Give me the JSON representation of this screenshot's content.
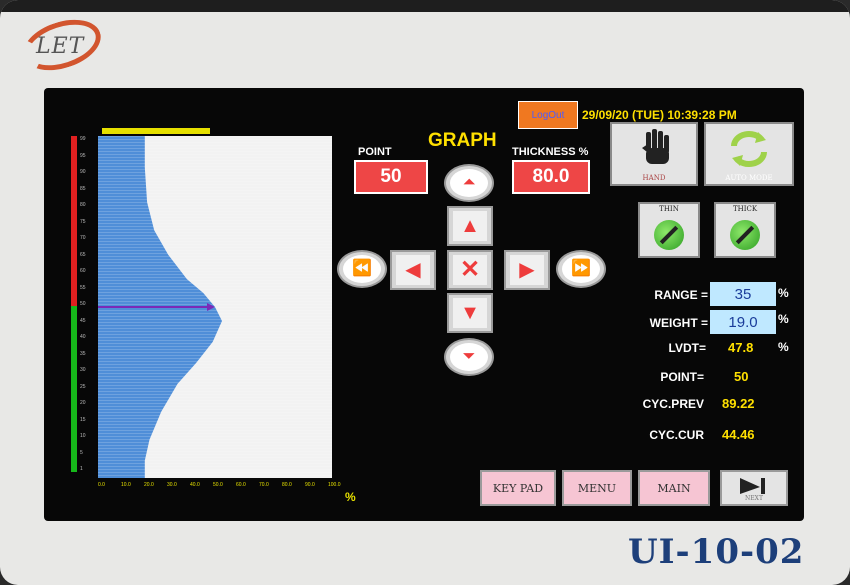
{
  "device": {
    "brand": "LET",
    "model": "UI-10-02"
  },
  "header": {
    "logout_label": "LogOut",
    "datetime": "29/09/20 (TUE) 10:39:28 PM",
    "title": "GRAPH"
  },
  "point_field": {
    "label": "POINT",
    "value": "50"
  },
  "thickness_field": {
    "label": "THICKNESS %",
    "value": "80.0"
  },
  "mode_buttons": {
    "hand": "HAND",
    "auto": "AUTO MODE",
    "thin": "THIN",
    "thick": "THICK"
  },
  "readouts": {
    "range": {
      "label": "RANGE =",
      "value": "35",
      "unit": "%"
    },
    "weight": {
      "label": "WEIGHT =",
      "value": "19.0",
      "unit": "%"
    },
    "lvdt": {
      "label": "LVDT=",
      "value": "47.8",
      "unit": "%"
    },
    "point": {
      "label": "POINT=",
      "value": "50"
    },
    "cyc_prev": {
      "label": "CYC.PREV",
      "value": "89.22"
    },
    "cyc_cur": {
      "label": "CYC.CUR",
      "value": "44.46"
    }
  },
  "bottom_nav": {
    "keypad": "KEY PAD",
    "menu": "MENU",
    "main": "MAIN",
    "next": "NEXT"
  },
  "graph": {
    "x_unit": "%",
    "x_ticks": [
      "0.0",
      "10.0",
      "20.0",
      "30.0",
      "40.0",
      "50.0",
      "60.0",
      "70.0",
      "80.0",
      "90.0",
      "100.0"
    ],
    "y_ticks": [
      "99",
      "95",
      "90",
      "85",
      "80",
      "75",
      "70",
      "65",
      "60",
      "55",
      "50",
      "45",
      "40",
      "35",
      "30",
      "25",
      "20",
      "15",
      "10",
      "5",
      "1"
    ],
    "current_point": 50
  },
  "chart_data": {
    "type": "area",
    "xlabel": "",
    "ylabel": "",
    "xlim": [
      0,
      100
    ],
    "ylim": [
      1,
      99
    ],
    "x": [
      20,
      20,
      21,
      24,
      30,
      38,
      45,
      50,
      53,
      49,
      42,
      34,
      27,
      22,
      20,
      20
    ],
    "y": [
      99,
      90,
      80,
      72,
      65,
      58,
      54,
      50,
      46,
      40,
      34,
      28,
      20,
      12,
      6,
      1
    ]
  },
  "colors": {
    "fill": "#4f8ed8",
    "plot_bg": "#f2f2f2",
    "marker": "#7a2ab8",
    "accent_red": "#ee4646",
    "accent_yellow": "#ffe000"
  }
}
